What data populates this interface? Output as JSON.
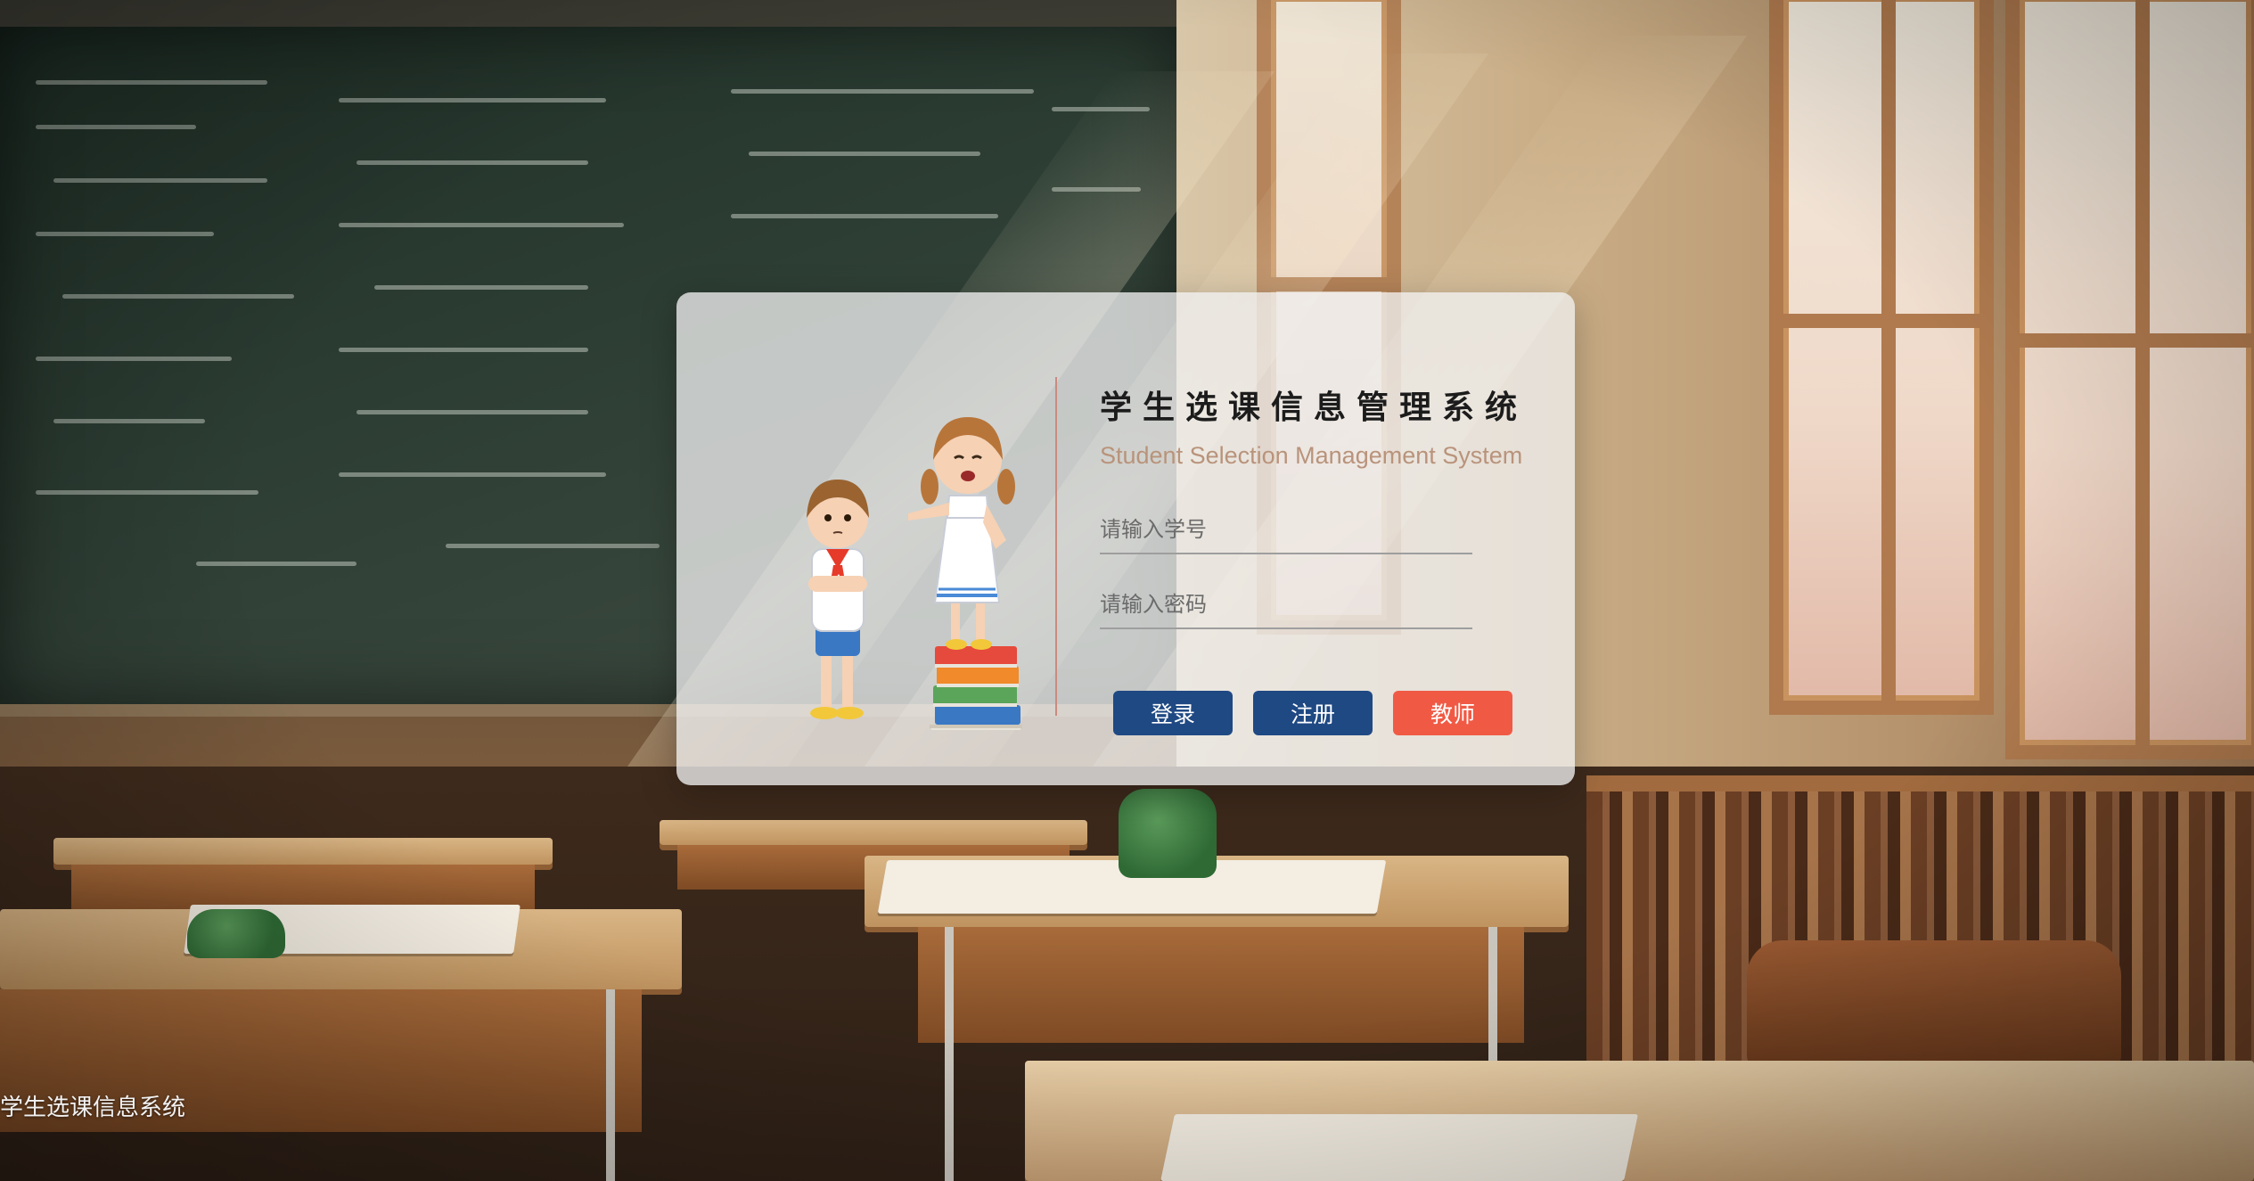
{
  "login": {
    "title": "学生选课信息管理系统",
    "subtitle": "Student Selection Management System",
    "student_id_placeholder": "请输入学号",
    "password_placeholder": "请输入密码",
    "login_label": "登录",
    "register_label": "注册",
    "teacher_label": "教师"
  },
  "footer": {
    "text": "学生选课信息系统"
  },
  "colors": {
    "primary_button": "#1f4983",
    "teacher_button": "#f05a45",
    "subtitle": "#b9937b",
    "divider": "#c98b7f"
  },
  "icons": {
    "illustration": "cartoon-students-illustration"
  }
}
